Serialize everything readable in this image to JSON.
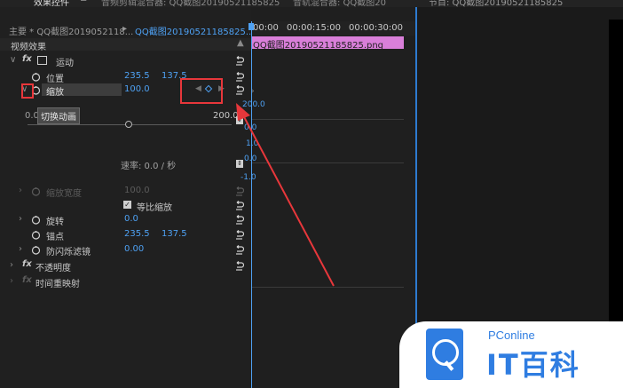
{
  "tabs": {
    "effect_controls": "效果控件",
    "audio_mixer": "音频剪辑混合器: QQ截图20190521185825",
    "audio_track_mixer": "音轨混合器: QQ截图20",
    "program": "节目: QQ截图20190521185825"
  },
  "breadcrumb": {
    "master": "主要 * QQ截图2019052118...",
    "clip": "QQ截图20190521185825..."
  },
  "section_title": "视频效果",
  "timecodes": [
    "00:00",
    "00:00:15:00",
    "00:00:30:00"
  ],
  "clip_label": "QQ截图20190521185825.png",
  "motion": {
    "label": "运动",
    "position": {
      "label": "位置",
      "x": "235.5",
      "y": "137.5"
    },
    "scale": {
      "label": "缩放",
      "value": "100.0"
    },
    "toggle_animation": "切换动画",
    "slider_min": "0.0",
    "slider_max": "200.0",
    "velocity": "速率: 0.0 / 秒",
    "scale_width": {
      "label": "缩放宽度",
      "value": "100.0"
    },
    "uniform_scale": "等比缩放",
    "rotation": {
      "label": "旋转",
      "value": "0.0"
    },
    "anchor": {
      "label": "锚点",
      "x": "235.5",
      "y": "137.5"
    },
    "anti_flicker": {
      "label": "防闪烁滤镜",
      "value": "0.00"
    }
  },
  "opacity": "不透明度",
  "time_remap": "时间重映射",
  "graph": {
    "top": "200.0",
    "mid": "0.0",
    "low": "1.0",
    "v_mid": "0.0",
    "v_low": "-1.0"
  },
  "watermark": {
    "brand": "PConline",
    "chars": "IT百科"
  },
  "colors": {
    "accent": "#4ea1f3",
    "clip": "#d97fd9",
    "annotation": "#e8373b"
  }
}
